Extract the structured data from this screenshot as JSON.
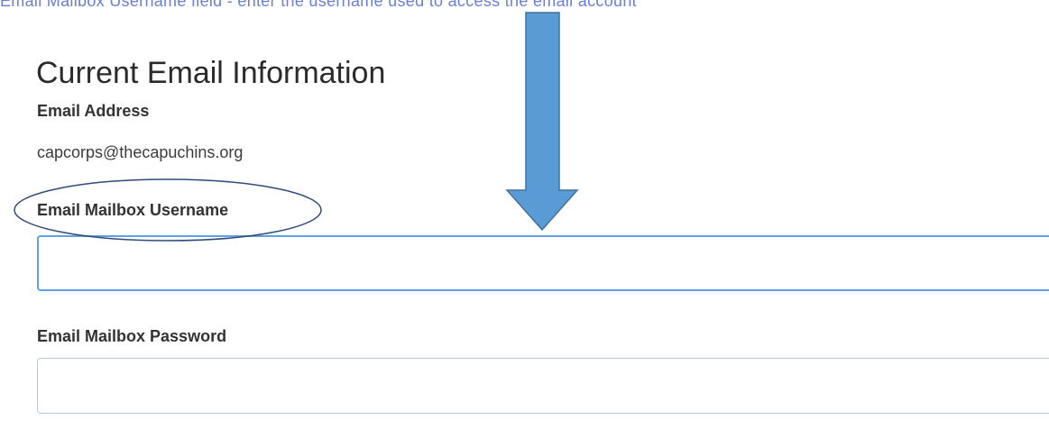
{
  "header_fragment": "Email Mailbox Username field - enter the username used to access the email account",
  "section": {
    "title": "Current Email Information"
  },
  "email_address": {
    "label": "Email Address",
    "value": "capcorps@thecapuchins.org"
  },
  "mailbox_username": {
    "label": "Email Mailbox Username",
    "value": ""
  },
  "mailbox_password": {
    "label": "Email Mailbox Password",
    "value": ""
  },
  "annotations": {
    "arrow_color": "#5b9bd5",
    "arrow_outline_color": "#41719c",
    "ellipse_color": "#2e4a7a"
  }
}
